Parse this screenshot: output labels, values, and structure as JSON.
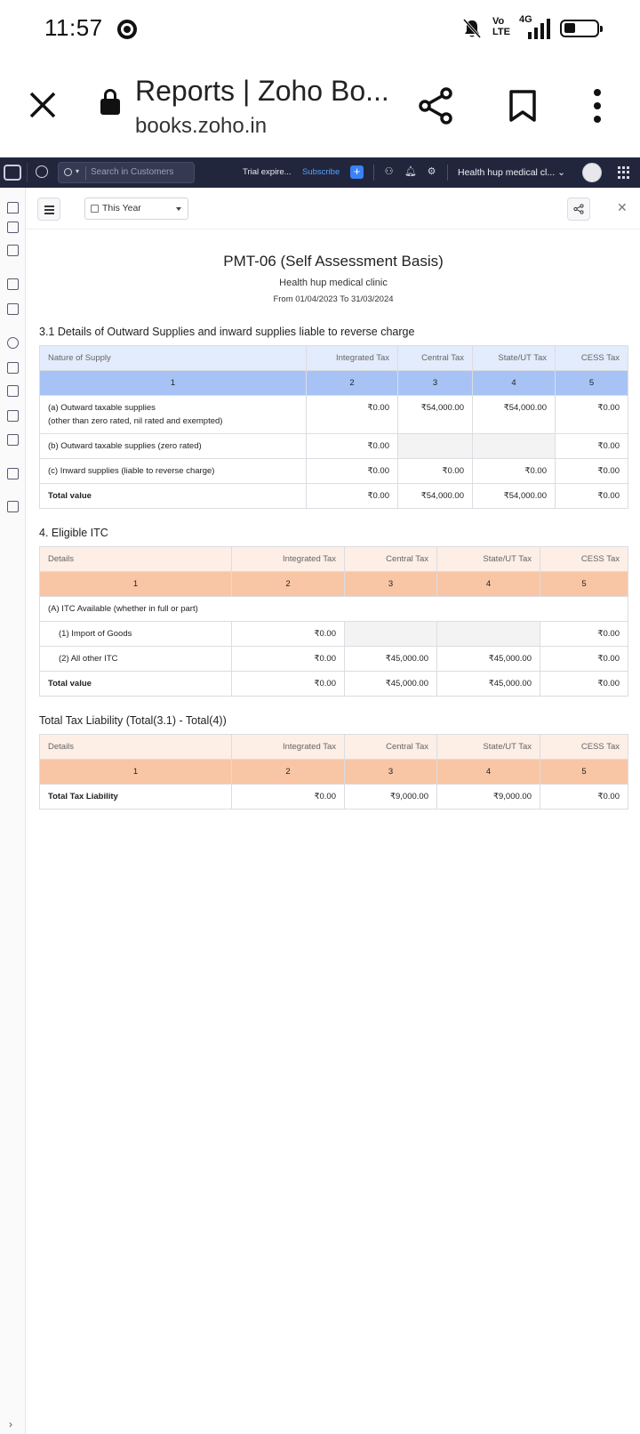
{
  "status_bar": {
    "time": "11:57",
    "volte": "Vo LTE",
    "network": "4G"
  },
  "browser": {
    "page_title": "Reports | Zoho Bo...",
    "url": "books.zoho.in"
  },
  "topbar": {
    "search_placeholder": "Search in Customers",
    "trial_text": "Trial expire...",
    "subscribe_label": "Subscribe",
    "add_label": "+",
    "org_name": "Health hup medical cl..."
  },
  "toolbar": {
    "period": "This Year"
  },
  "report": {
    "title": "PMT-06 (Self Assessment Basis)",
    "organization": "Health hup medical clinic",
    "date_range": "From 01/04/2023 To 31/03/2024"
  },
  "section1": {
    "title": "3.1 Details of Outward Supplies and inward supplies liable to reverse charge",
    "headers": [
      "Nature of Supply",
      "Integrated Tax",
      "Central Tax",
      "State/UT Tax",
      "CESS Tax"
    ],
    "col_numbers": [
      "1",
      "2",
      "3",
      "4",
      "5"
    ],
    "rows": [
      {
        "label": "(a) Outward taxable supplies",
        "label2": "(other than zero rated, nil rated and exempted)",
        "integrated": "₹0.00",
        "central": "₹54,000.00",
        "state": "₹54,000.00",
        "cess": "₹0.00"
      },
      {
        "label": "(b) Outward taxable supplies (zero rated)",
        "integrated": "₹0.00",
        "central": "",
        "state": "",
        "cess": "₹0.00"
      },
      {
        "label": "(c) Inward supplies (liable to reverse charge)",
        "integrated": "₹0.00",
        "central": "₹0.00",
        "state": "₹0.00",
        "cess": "₹0.00"
      },
      {
        "label": "Total value",
        "integrated": "₹0.00",
        "central": "₹54,000.00",
        "state": "₹54,000.00",
        "cess": "₹0.00"
      }
    ]
  },
  "section2": {
    "title": "4. Eligible ITC",
    "headers": [
      "Details",
      "Integrated Tax",
      "Central Tax",
      "State/UT Tax",
      "CESS Tax"
    ],
    "col_numbers": [
      "1",
      "2",
      "3",
      "4",
      "5"
    ],
    "group_label": "(A) ITC Available (whether in full or part)",
    "rows": [
      {
        "label": "(1) Import of Goods",
        "integrated": "₹0.00",
        "central": "",
        "state": "",
        "cess": "₹0.00"
      },
      {
        "label": "(2) All other ITC",
        "integrated": "₹0.00",
        "central": "₹45,000.00",
        "state": "₹45,000.00",
        "cess": "₹0.00"
      },
      {
        "label": "Total value",
        "integrated": "₹0.00",
        "central": "₹45,000.00",
        "state": "₹45,000.00",
        "cess": "₹0.00"
      }
    ]
  },
  "section3": {
    "title": "Total Tax Liability (Total(3.1) - Total(4))",
    "headers": [
      "Details",
      "Integrated Tax",
      "Central Tax",
      "State/UT Tax",
      "CESS Tax"
    ],
    "col_numbers": [
      "1",
      "2",
      "3",
      "4",
      "5"
    ],
    "rows": [
      {
        "label": "Total Tax Liability",
        "integrated": "₹0.00",
        "central": "₹9,000.00",
        "state": "₹9,000.00",
        "cess": "₹0.00"
      }
    ]
  }
}
